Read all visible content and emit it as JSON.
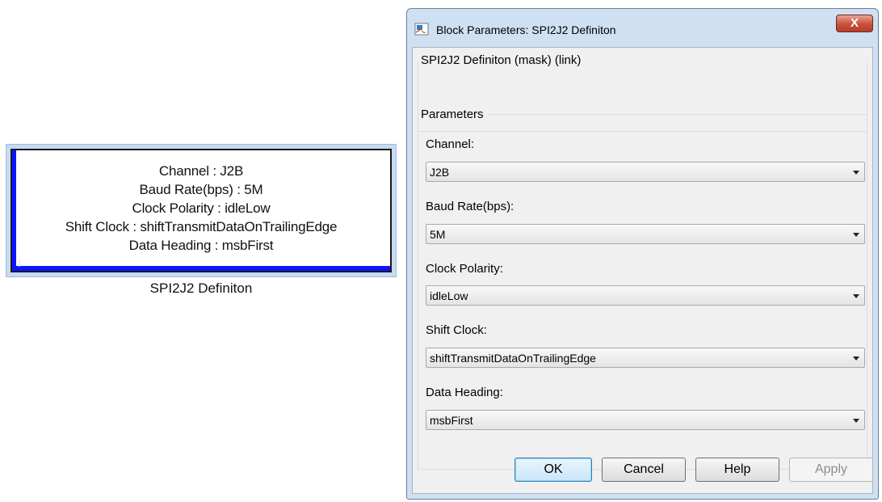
{
  "block": {
    "lines": [
      "Channel : J2B",
      "Baud Rate(bps) : 5M",
      "Clock Polarity : idleLow",
      "Shift Clock : shiftTransmitDataOnTrailingEdge",
      "Data Heading : msbFirst"
    ],
    "caption": "SPI2J2 Definiton"
  },
  "dialog": {
    "title": "Block Parameters: SPI2J2 Definiton",
    "close_label": "X",
    "description_title": "SPI2J2 Definiton (mask) (link)",
    "parameters_title": "Parameters",
    "fields": {
      "channel": {
        "label": "Channel:",
        "value": "J2B"
      },
      "baud_rate": {
        "label": "Baud Rate(bps):",
        "value": "5M"
      },
      "clock_polarity": {
        "label": "Clock Polarity:",
        "value": "idleLow"
      },
      "shift_clock": {
        "label": "Shift Clock:",
        "value": "shiftTransmitDataOnTrailingEdge"
      },
      "data_heading": {
        "label": "Data Heading:",
        "value": "msbFirst"
      }
    },
    "buttons": {
      "ok": "OK",
      "cancel": "Cancel",
      "help": "Help",
      "apply": "Apply"
    }
  },
  "colors": {
    "block_accent": "#0a14ff",
    "dialog_frame": "#cfe0f2",
    "close_button": "#c7503b"
  },
  "icons": {
    "app_icon": "simulink-block-icon",
    "port_marker": "input-port-icon",
    "dropdown": "chevron-down-icon"
  }
}
